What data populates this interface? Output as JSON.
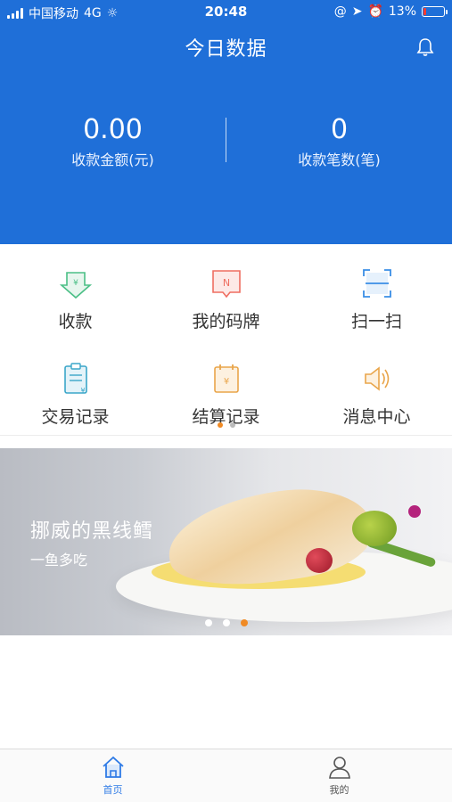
{
  "status_bar": {
    "carrier": "中国移动",
    "network": "4G",
    "time": "20:48",
    "battery": "13%",
    "battery_level": 0.13
  },
  "header": {
    "title": "今日数据"
  },
  "stats": [
    {
      "value": "0.00",
      "label": "收款金额(元)"
    },
    {
      "value": "0",
      "label": "收款笔数(笔)"
    }
  ],
  "grid": [
    {
      "label": "收款",
      "icon": "receive-payment-icon"
    },
    {
      "label": "我的码牌",
      "icon": "qr-code-card-icon"
    },
    {
      "label": "扫一扫",
      "icon": "scan-icon"
    },
    {
      "label": "交易记录",
      "icon": "transaction-record-icon"
    },
    {
      "label": "结算记录",
      "icon": "settlement-record-icon"
    },
    {
      "label": "消息中心",
      "icon": "speaker-icon"
    }
  ],
  "grid_page": {
    "count": 2,
    "active": 0
  },
  "banner": {
    "headline": "挪威的黑线鳕",
    "subline": "一鱼多吃",
    "pages": 3,
    "active": 2
  },
  "tabbar": [
    {
      "label": "首页",
      "icon": "home-icon"
    },
    {
      "label": "我的",
      "icon": "user-icon"
    }
  ],
  "colors": {
    "header_blue": "#1f6fd8",
    "accent_orange": "#f08a24",
    "tab_active": "#2f7be6",
    "battery_low": "#ff3b30"
  }
}
